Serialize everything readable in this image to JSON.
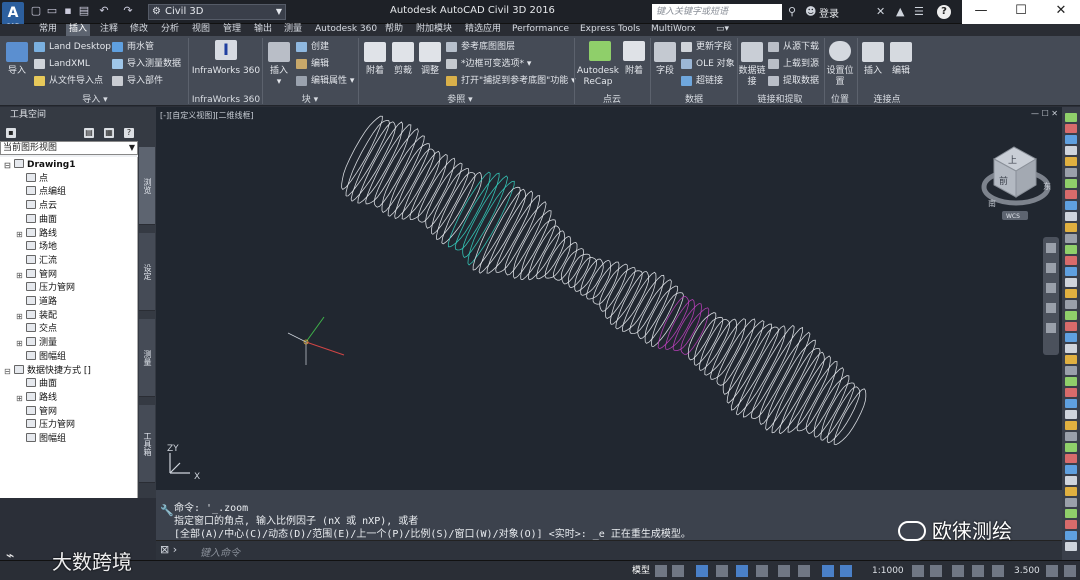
{
  "window": {
    "title": "Autodesk AutoCAD Civil 3D 2016",
    "workspace": "Civil 3D",
    "search_placeholder": "键入关键字或短语",
    "login": "登录",
    "help": "?"
  },
  "tabs": [
    "常用",
    "插入",
    "注释",
    "修改",
    "分析",
    "视图",
    "管理",
    "输出",
    "测量",
    "Autodesk 360",
    "帮助",
    "附加模块",
    "精选应用",
    "Performance",
    "Express Tools",
    "MultiWorx"
  ],
  "active_tab": "插入",
  "ribbon": {
    "import": {
      "title": "导入",
      "big": "导入",
      "rows": [
        "Land Desktop",
        "LandXML",
        "从文件导入点",
        "雨水管",
        "导入测量数据",
        "导入部件"
      ]
    },
    "infraworks": {
      "title": "InfraWorks 360",
      "big": "InfraWorks 360"
    },
    "block": {
      "title": "块",
      "big": "插入",
      "rows": [
        "创建",
        "编辑",
        "编辑属性"
      ]
    },
    "reference": {
      "title": "参照",
      "bigs": [
        "附着",
        "剪裁",
        "调整"
      ],
      "rows": [
        "参考底图图层",
        "*边框可变选项*",
        "打开\"捕捉到参考底图\"功能"
      ]
    },
    "pointcloud": {
      "title": "点云",
      "bigs": [
        "Autodesk ReCap",
        "附着"
      ]
    },
    "data": {
      "title": "数据",
      "bigs": [
        "字段"
      ],
      "rows": [
        "更新字段",
        "OLE 对象",
        "超链接"
      ]
    },
    "link": {
      "title": "链接和提取",
      "bigs": [
        "数据链接"
      ],
      "rows": [
        "从源下载",
        "上载到源",
        "提取数据"
      ]
    },
    "location": {
      "title": "位置",
      "bigs": [
        "设置位置"
      ]
    },
    "connection": {
      "title": "连接点",
      "bigs": [
        "插入",
        "编辑"
      ]
    }
  },
  "toolspace": {
    "title": "工具空间",
    "view_select": "当前图形视图",
    "tree": [
      {
        "label": "Drawing1",
        "level": 0,
        "bold": true,
        "exp": "⊟"
      },
      {
        "label": "点",
        "level": 1,
        "exp": ""
      },
      {
        "label": "点编组",
        "level": 1,
        "exp": ""
      },
      {
        "label": "点云",
        "level": 1,
        "exp": ""
      },
      {
        "label": "曲面",
        "level": 1,
        "exp": ""
      },
      {
        "label": "路线",
        "level": 1,
        "exp": "⊞"
      },
      {
        "label": "场地",
        "level": 1,
        "exp": ""
      },
      {
        "label": "汇流",
        "level": 1,
        "exp": ""
      },
      {
        "label": "管网",
        "level": 1,
        "exp": "⊞"
      },
      {
        "label": "压力管网",
        "level": 1,
        "exp": ""
      },
      {
        "label": "道路",
        "level": 1,
        "exp": ""
      },
      {
        "label": "装配",
        "level": 1,
        "exp": "⊞"
      },
      {
        "label": "交点",
        "level": 1,
        "exp": ""
      },
      {
        "label": "测量",
        "level": 1,
        "exp": "⊞"
      },
      {
        "label": "图幅组",
        "level": 1,
        "exp": ""
      },
      {
        "label": "数据快捷方式 []",
        "level": 0,
        "exp": "⊟"
      },
      {
        "label": "曲面",
        "level": 1,
        "exp": ""
      },
      {
        "label": "路线",
        "level": 1,
        "exp": "⊞"
      },
      {
        "label": "管网",
        "level": 1,
        "exp": ""
      },
      {
        "label": "压力管网",
        "level": 1,
        "exp": ""
      },
      {
        "label": "图幅组",
        "level": 1,
        "exp": ""
      }
    ],
    "vtabs": [
      "浏览",
      "设定",
      "测量",
      "工具箱"
    ]
  },
  "viewport": {
    "label": "[-][自定义视图][二维线框]",
    "ucs_label": "WCS",
    "viewcube": {
      "top": "上",
      "front": "前",
      "south": "南",
      "east": "东"
    }
  },
  "command": {
    "lines": [
      "命令: '_.zoom",
      "指定窗口的角点, 输入比例因子 (nX 或 nXP), 或者",
      "[全部(A)/中心(C)/动态(D)/范围(E)/上一个(P)/比例(S)/窗口(W)/对象(O)] <实时>: _e 正在重生成模型。"
    ],
    "input_placeholder": "键入命令"
  },
  "status": {
    "model": "模型",
    "scale": "1:1000",
    "value": "3.500"
  },
  "watermark": {
    "left": "大数跨境",
    "right": "欧徕测绘"
  },
  "colors": {
    "accent_cyan": "#35d0c0",
    "accent_magenta": "#c040c0"
  }
}
